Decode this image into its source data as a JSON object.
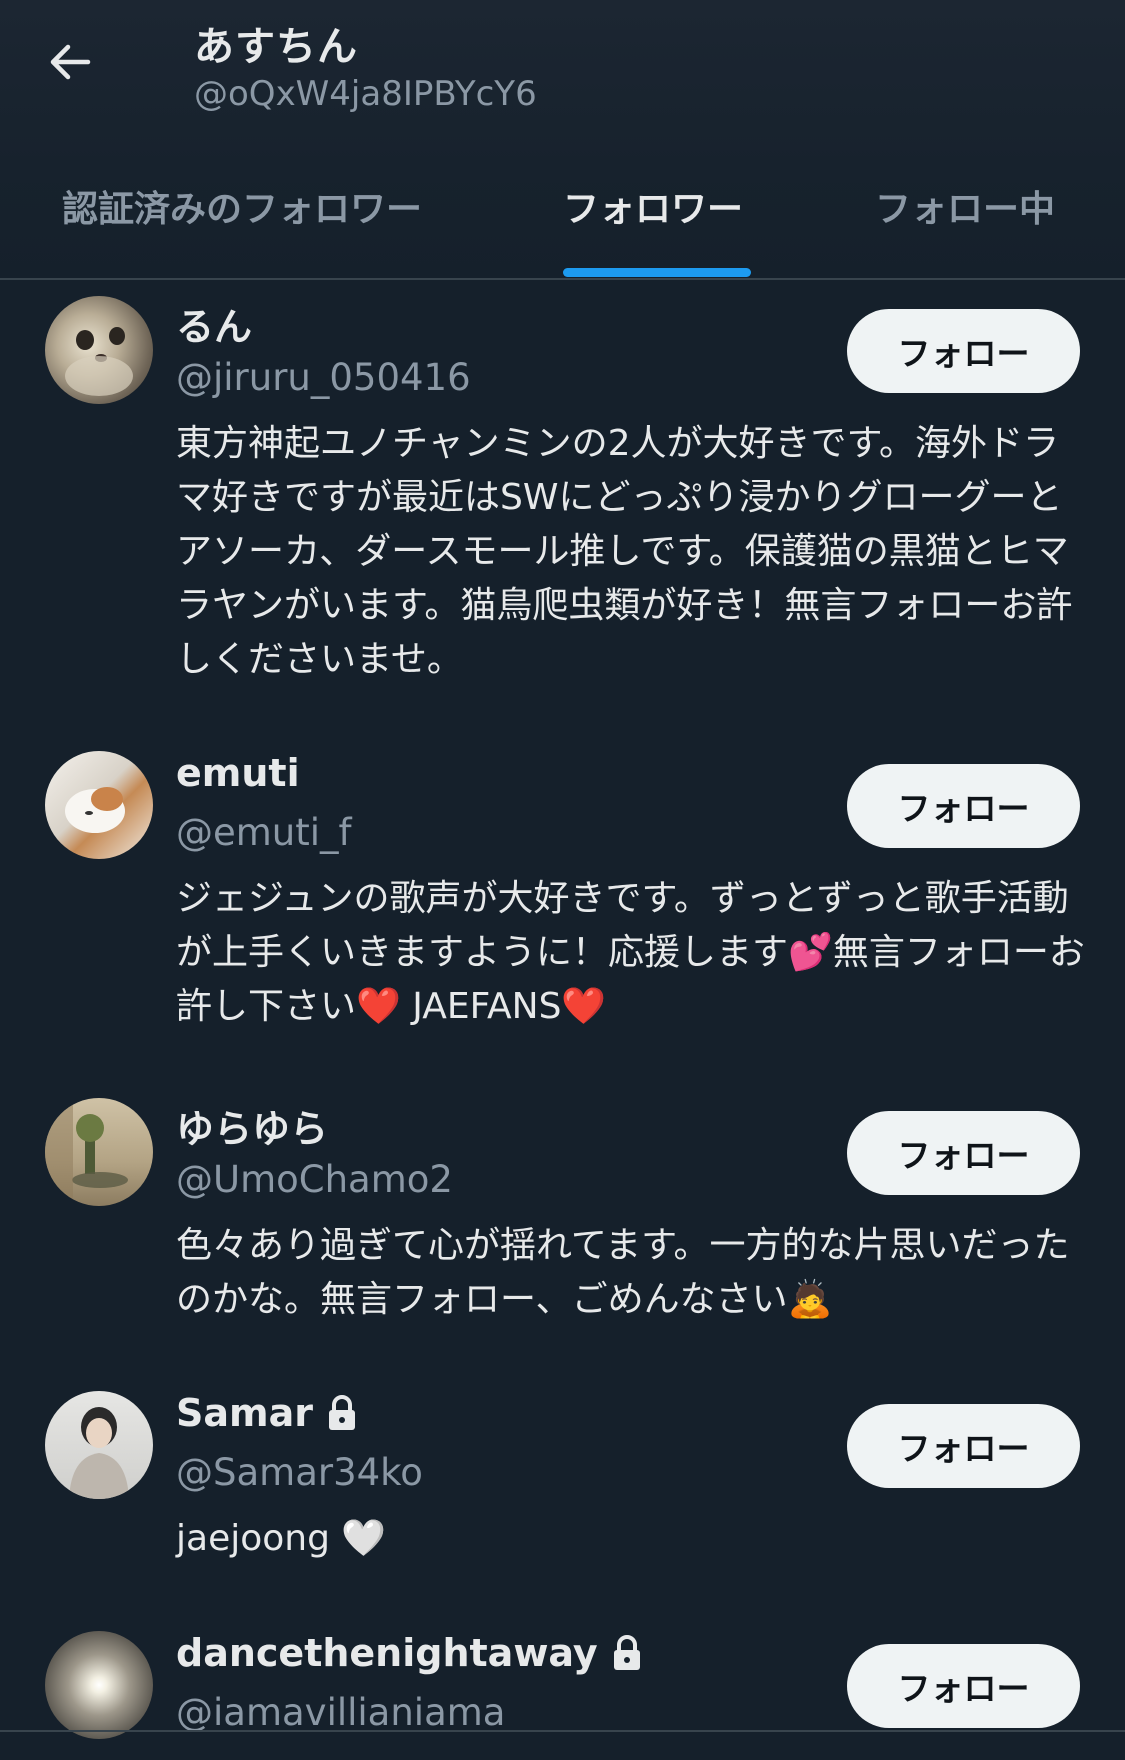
{
  "header": {
    "title": "あすちん",
    "handle": "@oQxW4ja8IPBYcY6"
  },
  "tabs": [
    {
      "label": "認証済みのフォロワー",
      "active": false
    },
    {
      "label": "フォロワー",
      "active": true
    },
    {
      "label": "フォロー中",
      "active": false
    }
  ],
  "colors": {
    "background": "#15202b",
    "accent": "#1d9bf0",
    "secondary_text": "#8b98a5",
    "button_bg": "#eff3f4"
  },
  "users": [
    {
      "name": "るん",
      "handle": "@jiruru_050416",
      "bio": "東方神起ユノチャンミンの2人が大好きです。海外ドラマ好きですが最近はSWにどっぷり浸かりグローグーとアソーカ、ダースモール推しです。保護猫の黒猫とヒマラヤンがいます。猫鳥爬虫類が好き！無言フォローお許しくださいませ。",
      "follow_label": "フォロー",
      "locked": false,
      "avatar_icon": "cat-photo"
    },
    {
      "name": "emuti",
      "handle": "@emuti_f",
      "bio": "ジェジュンの歌声が大好きです。ずっとずっと歌手活動が上手くいきますように！応援します💕無言フォローお許し下さい❤️ JAEFANS❤️",
      "follow_label": "フォロー",
      "locked": false,
      "avatar_icon": "cat-photo"
    },
    {
      "name": "ゆらゆら",
      "handle": "@UmoChamo2",
      "bio": "色々あり過ぎて心が揺れてます。一方的な片思いだったのかな。無言フォロー、ごめんなさい🙇",
      "follow_label": "フォロー",
      "locked": false,
      "avatar_icon": "plant-photo"
    },
    {
      "name": "Samar",
      "handle": "@Samar34ko",
      "bio": "jaejoong 🤍",
      "follow_label": "フォロー",
      "locked": true,
      "avatar_icon": "person-photo"
    },
    {
      "name": "dancethenightaway",
      "handle": "@iamavillianiama",
      "bio": "",
      "follow_label": "フォロー",
      "locked": true,
      "avatar_icon": "light-photo"
    }
  ]
}
